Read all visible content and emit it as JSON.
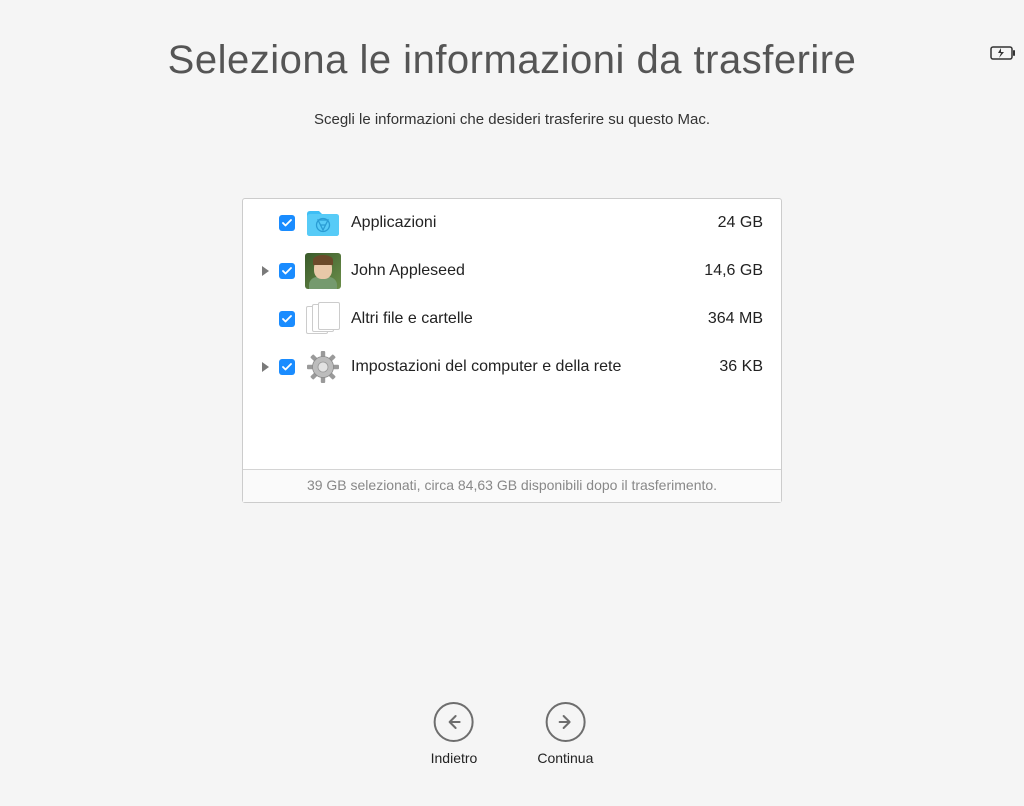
{
  "title": "Seleziona le informazioni da trasferire",
  "subtitle": "Scegli le informazioni che desideri trasferire su questo Mac.",
  "items": [
    {
      "label": "Applicazioni",
      "size": "24 GB",
      "expandable": false
    },
    {
      "label": "John Appleseed",
      "size": "14,6 GB",
      "expandable": true
    },
    {
      "label": "Altri file e cartelle",
      "size": "364 MB",
      "expandable": false
    },
    {
      "label": "Impostazioni del computer e della rete",
      "size": "36 KB",
      "expandable": true
    }
  ],
  "footer": "39 GB selezionati, circa 84,63 GB disponibili dopo il trasferimento.",
  "nav": {
    "back": "Indietro",
    "continue": "Continua"
  }
}
